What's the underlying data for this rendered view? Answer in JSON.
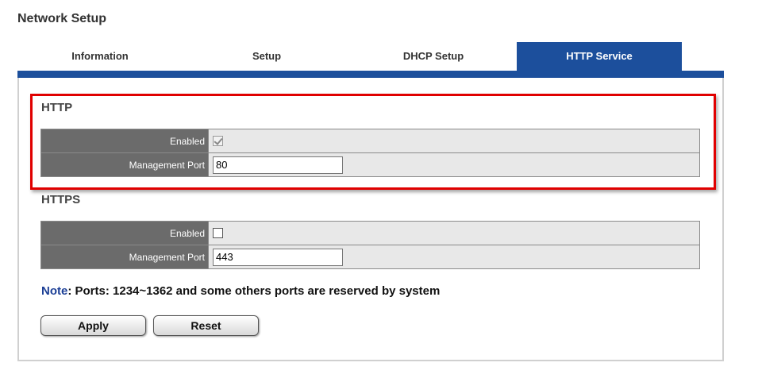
{
  "page": {
    "title": "Network Setup"
  },
  "tabs": [
    {
      "label": "Information",
      "active": false
    },
    {
      "label": "Setup",
      "active": false
    },
    {
      "label": "DHCP Setup",
      "active": false
    },
    {
      "label": "HTTP Service",
      "active": true
    }
  ],
  "http": {
    "title": "HTTP",
    "enabled_label": "Enabled",
    "enabled": true,
    "port_label": "Management Port",
    "port_value": "80"
  },
  "https": {
    "title": "HTTPS",
    "enabled_label": "Enabled",
    "enabled": false,
    "port_label": "Management Port",
    "port_value": "443"
  },
  "note": {
    "label": "Note",
    "text": ": Ports: 1234~1362 and some others ports are reserved by system"
  },
  "buttons": {
    "apply": "Apply",
    "reset": "Reset"
  },
  "colors": {
    "accent": "#1c4f9c",
    "highlight": "#e00000",
    "label_bg": "#6b6b6b"
  }
}
